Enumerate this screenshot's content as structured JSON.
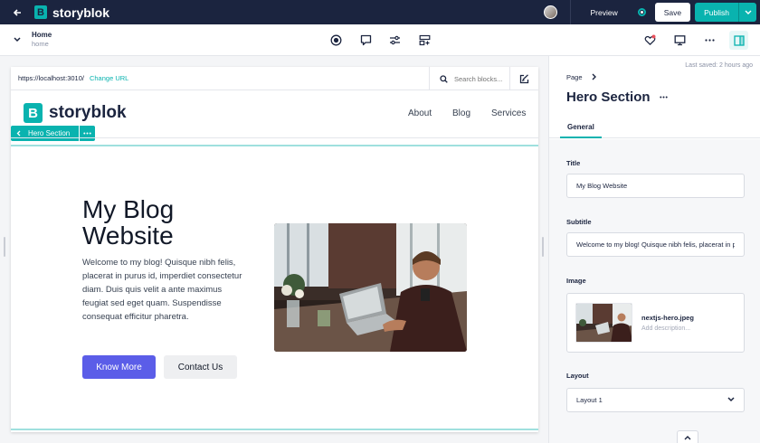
{
  "topbar": {
    "app_name": "storyblok",
    "preview_label": "Preview",
    "save_label": "Save",
    "publish_label": "Publish"
  },
  "subbar": {
    "story_title": "Home",
    "story_slug": "home"
  },
  "preview": {
    "url": "https://localhost:3010/",
    "change_url_label": "Change URL",
    "search_placeholder": "Search blocks...",
    "site": {
      "logo_text": "storyblok",
      "nav": [
        "About",
        "Blog",
        "Services"
      ]
    },
    "block_tag": "Hero Section",
    "hero": {
      "title": "My Blog Website",
      "subtitle": "Welcome to my blog! Quisque nibh felis, placerat in purus id, imperdiet consectetur diam. Duis quis velit a ante maximus feugiat sed eget quam. Suspendisse consequat efficitur pharetra.",
      "primary_button": "Know More",
      "secondary_button": "Contact Us"
    }
  },
  "panel": {
    "last_saved": "Last saved: 2 hours ago",
    "breadcrumb": "Page",
    "title": "Hero Section",
    "tab": "General",
    "fields": {
      "title_label": "Title",
      "title_value": "My Blog Website",
      "subtitle_label": "Subtitle",
      "subtitle_value": "Welcome to my blog! Quisque nibh felis, placerat in purus id",
      "image_label": "Image",
      "image_filename": "nextjs-hero.jpeg",
      "image_description_placeholder": "Add description...",
      "layout_label": "Layout",
      "layout_value": "Layout 1"
    }
  },
  "colors": {
    "brand_teal": "#09b3af",
    "navy": "#1b243f",
    "primary_button": "#5b5de8"
  },
  "icons": [
    "back-arrow-icon",
    "chevron-down-icon",
    "record-icon",
    "comment-icon",
    "sliders-icon",
    "blocks-icon",
    "heart-icon",
    "monitor-icon",
    "more-icon",
    "panel-layout-icon",
    "search-icon",
    "edit-icon",
    "chevron-left-icon",
    "chevron-right-icon"
  ]
}
